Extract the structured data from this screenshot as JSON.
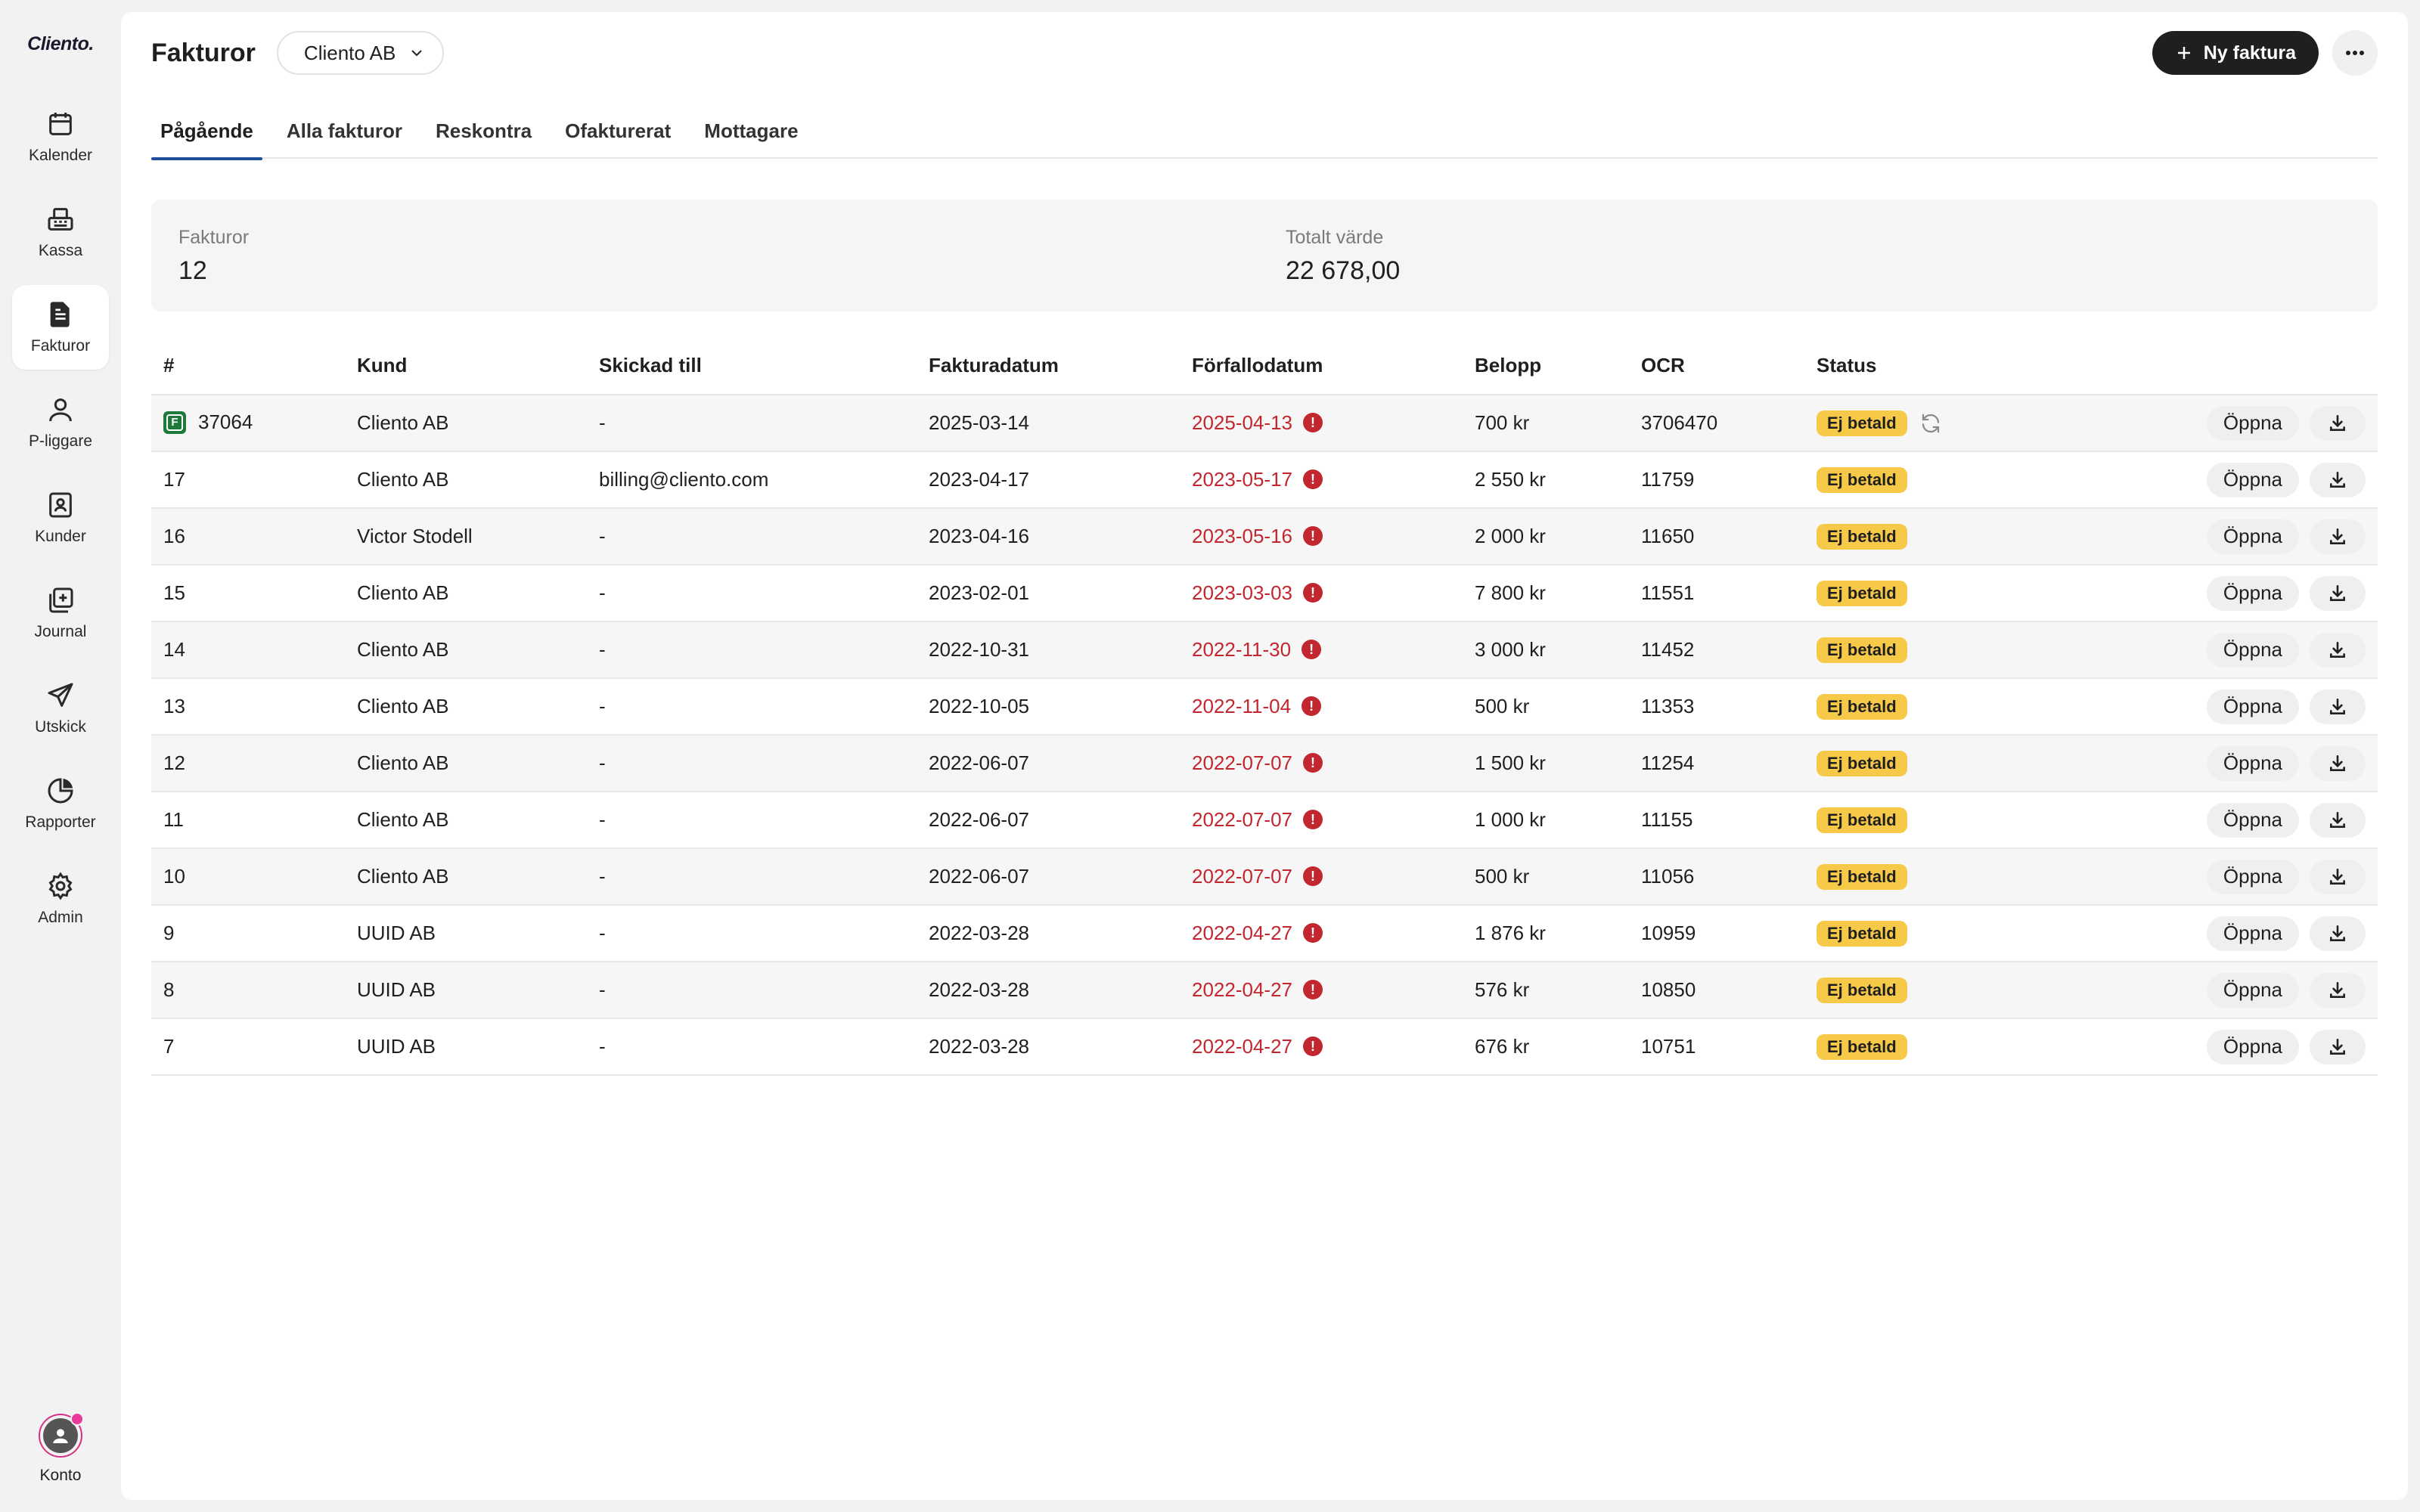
{
  "app": {
    "logo": "Cliento."
  },
  "sidebar": {
    "items": [
      {
        "label": "Kalender",
        "icon": "calendar-icon",
        "active": false
      },
      {
        "label": "Kassa",
        "icon": "cash-register-icon",
        "active": false
      },
      {
        "label": "Fakturor",
        "icon": "invoice-document-icon",
        "active": true
      },
      {
        "label": "P-liggare",
        "icon": "person-icon",
        "active": false
      },
      {
        "label": "Kunder",
        "icon": "contacts-icon",
        "active": false
      },
      {
        "label": "Journal",
        "icon": "journal-icon",
        "active": false
      },
      {
        "label": "Utskick",
        "icon": "send-icon",
        "active": false
      },
      {
        "label": "Rapporter",
        "icon": "pie-chart-icon",
        "active": false
      },
      {
        "label": "Admin",
        "icon": "gear-icon",
        "active": false
      }
    ],
    "account_label": "Konto"
  },
  "header": {
    "title": "Fakturor",
    "company": "Cliento AB",
    "new_button": "Ny faktura"
  },
  "tabs": [
    {
      "label": "Pågående",
      "active": true
    },
    {
      "label": "Alla fakturor",
      "active": false
    },
    {
      "label": "Reskontra",
      "active": false
    },
    {
      "label": "Ofakturerat",
      "active": false
    },
    {
      "label": "Mottagare",
      "active": false
    }
  ],
  "summary": {
    "invoices_label": "Fakturor",
    "invoices_value": "12",
    "total_label": "Totalt värde",
    "total_value": "22 678,00"
  },
  "table": {
    "columns": [
      "#",
      "Kund",
      "Skickad till",
      "Fakturadatum",
      "Förfallodatum",
      "Belopp",
      "OCR",
      "Status"
    ],
    "open_label": "Öppna",
    "rows": [
      {
        "num": "37064",
        "customer": "Cliento AB",
        "sent_to": "-",
        "invoice_date": "2025-03-14",
        "due_date": "2025-04-13",
        "amount": "700 kr",
        "ocr": "3706470",
        "status": "Ej betald",
        "fortnox": true,
        "sync": true
      },
      {
        "num": "17",
        "customer": "Cliento AB",
        "sent_to": "billing@cliento.com",
        "invoice_date": "2023-04-17",
        "due_date": "2023-05-17",
        "amount": "2 550 kr",
        "ocr": "11759",
        "status": "Ej betald"
      },
      {
        "num": "16",
        "customer": "Victor Stodell",
        "sent_to": "-",
        "invoice_date": "2023-04-16",
        "due_date": "2023-05-16",
        "amount": "2 000 kr",
        "ocr": "11650",
        "status": "Ej betald"
      },
      {
        "num": "15",
        "customer": "Cliento AB",
        "sent_to": "-",
        "invoice_date": "2023-02-01",
        "due_date": "2023-03-03",
        "amount": "7 800 kr",
        "ocr": "11551",
        "status": "Ej betald"
      },
      {
        "num": "14",
        "customer": "Cliento AB",
        "sent_to": "-",
        "invoice_date": "2022-10-31",
        "due_date": "2022-11-30",
        "amount": "3 000 kr",
        "ocr": "11452",
        "status": "Ej betald"
      },
      {
        "num": "13",
        "customer": "Cliento AB",
        "sent_to": "-",
        "invoice_date": "2022-10-05",
        "due_date": "2022-11-04",
        "amount": "500 kr",
        "ocr": "11353",
        "status": "Ej betald"
      },
      {
        "num": "12",
        "customer": "Cliento AB",
        "sent_to": "-",
        "invoice_date": "2022-06-07",
        "due_date": "2022-07-07",
        "amount": "1 500 kr",
        "ocr": "11254",
        "status": "Ej betald"
      },
      {
        "num": "11",
        "customer": "Cliento AB",
        "sent_to": "-",
        "invoice_date": "2022-06-07",
        "due_date": "2022-07-07",
        "amount": "1 000 kr",
        "ocr": "11155",
        "status": "Ej betald"
      },
      {
        "num": "10",
        "customer": "Cliento AB",
        "sent_to": "-",
        "invoice_date": "2022-06-07",
        "due_date": "2022-07-07",
        "amount": "500 kr",
        "ocr": "11056",
        "status": "Ej betald"
      },
      {
        "num": "9",
        "customer": "UUID AB",
        "sent_to": "-",
        "invoice_date": "2022-03-28",
        "due_date": "2022-04-27",
        "amount": "1 876 kr",
        "ocr": "10959",
        "status": "Ej betald"
      },
      {
        "num": "8",
        "customer": "UUID AB",
        "sent_to": "-",
        "invoice_date": "2022-03-28",
        "due_date": "2022-04-27",
        "amount": "576 kr",
        "ocr": "10850",
        "status": "Ej betald"
      },
      {
        "num": "7",
        "customer": "UUID AB",
        "sent_to": "-",
        "invoice_date": "2022-03-28",
        "due_date": "2022-04-27",
        "amount": "676 kr",
        "ocr": "10751",
        "status": "Ej betald"
      }
    ]
  },
  "colors": {
    "overdue": "#c2262e",
    "status_badge": "#f7c948",
    "primary_button": "#1f1f1f",
    "active_tab_underline": "#1f4e9c",
    "notification_dot": "#e6399b"
  }
}
